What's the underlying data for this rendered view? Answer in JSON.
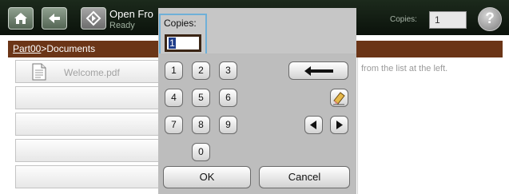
{
  "header": {
    "title": "Open Fro",
    "status": "Ready",
    "copies_label": "Copies:",
    "copies_value": "1",
    "help_symbol": "?"
  },
  "breadcrumb": {
    "root": "Part00",
    "separator": ">",
    "current": "Documents"
  },
  "file_list": [
    {
      "name": "Welcome.pdf"
    },
    {
      "name": ""
    },
    {
      "name": ""
    },
    {
      "name": ""
    },
    {
      "name": ""
    }
  ],
  "hint": "from the list at the left.",
  "keypad": {
    "field_label": "Copies:",
    "field_value": "1",
    "digits": [
      "1",
      "2",
      "3",
      "4",
      "5",
      "6",
      "7",
      "8",
      "9",
      "0"
    ],
    "ok_label": "OK",
    "cancel_label": "Cancel"
  }
}
